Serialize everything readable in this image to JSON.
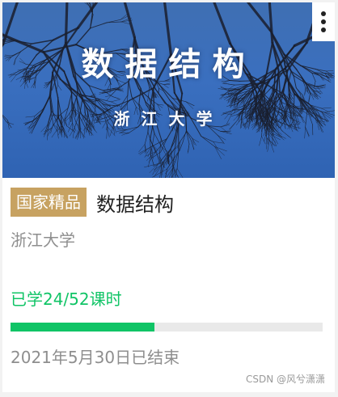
{
  "course_card": {
    "cover": {
      "title": "数据结构",
      "subtitle": "浙江大学",
      "colors": {
        "sky_top": "#3f6fb3",
        "sky_bottom": "#2f63b3",
        "branches": "#1a1f2e"
      }
    },
    "menu_icon": "vertical-dots-icon",
    "badge": {
      "label": "国家精品",
      "color": "#c7a261"
    },
    "title": "数据结构",
    "school": "浙江大学",
    "progress": {
      "text": "已学24/52课时",
      "completed": 24,
      "total": 52,
      "color": "#10c466",
      "track_color": "#e9e9e9"
    },
    "end_date": "2021年5月30日已结束"
  },
  "watermark": "CSDN @风兮潇潇"
}
